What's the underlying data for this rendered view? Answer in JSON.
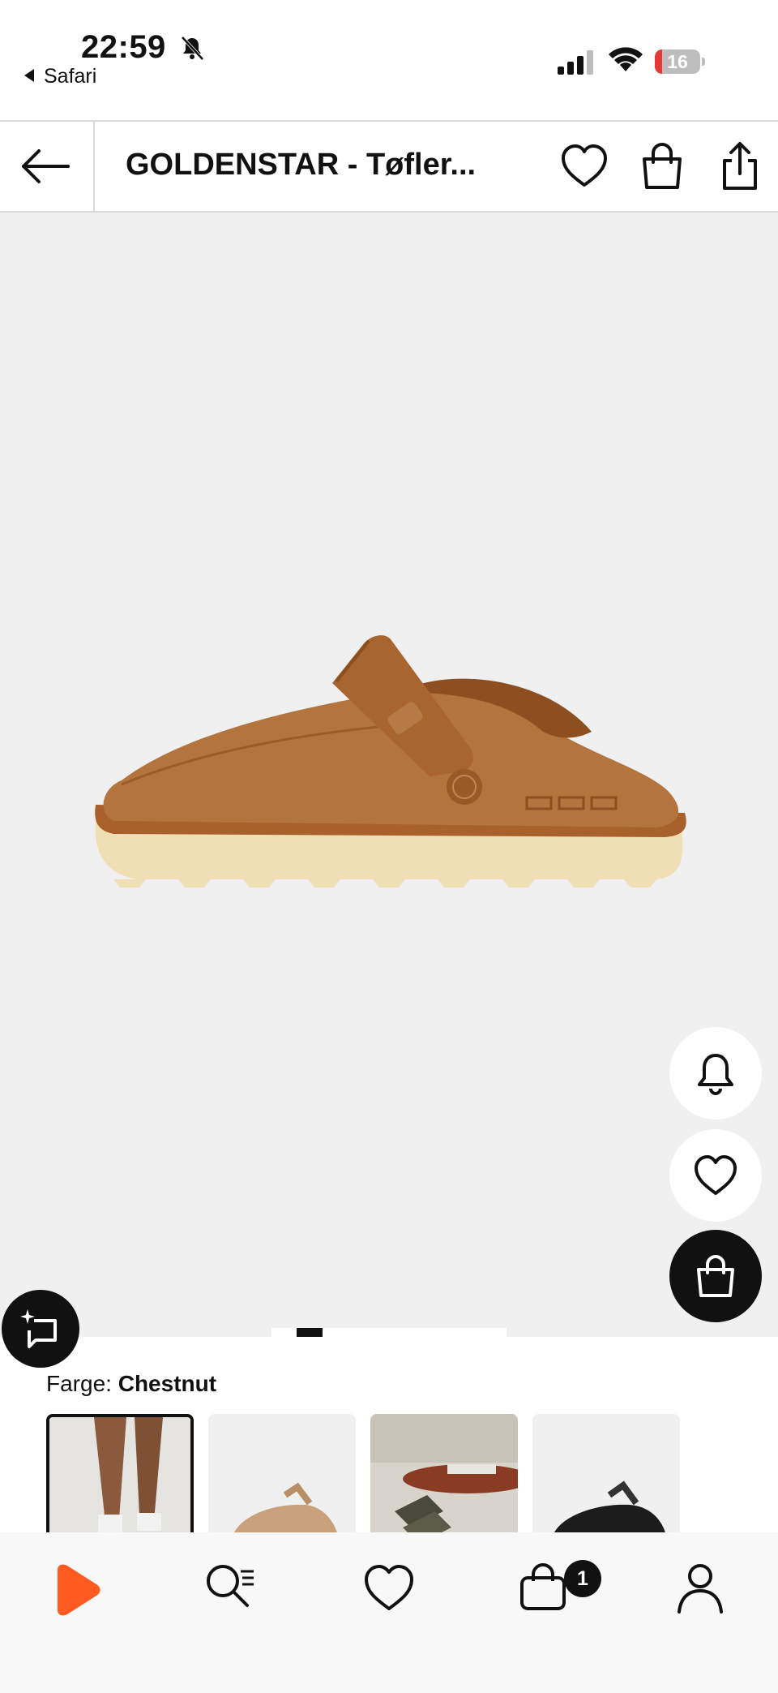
{
  "status_bar": {
    "time": "22:59",
    "back_app_label": "Safari",
    "battery_level": "16",
    "battery_fraction": 0.16,
    "battery_color": "#e53935"
  },
  "header": {
    "title": "GOLDENSTAR - Tøfler...",
    "icons": [
      "back-arrow-icon",
      "heart-icon",
      "shopping-bag-icon",
      "share-icon"
    ]
  },
  "product": {
    "image": "tan suede clog slipper with strap",
    "image_count_indicator": {
      "active_index": 0
    },
    "floating_actions": [
      "bell-icon",
      "heart-icon",
      "shopping-bag-icon"
    ],
    "ai_assistant_icon": "sparkle-chat-icon"
  },
  "color": {
    "label_prefix": "Farge:",
    "selected": "Chestnut",
    "swatches": [
      "model-legs-photo",
      "sand-clog",
      "lifestyle-table",
      "black-clog"
    ]
  },
  "bottom_nav": {
    "items": [
      "home-logo-icon",
      "search-icon",
      "wishlist-icon",
      "cart-icon",
      "profile-icon"
    ],
    "cart_badge": "1",
    "brand_color": "#ff5a1f"
  }
}
